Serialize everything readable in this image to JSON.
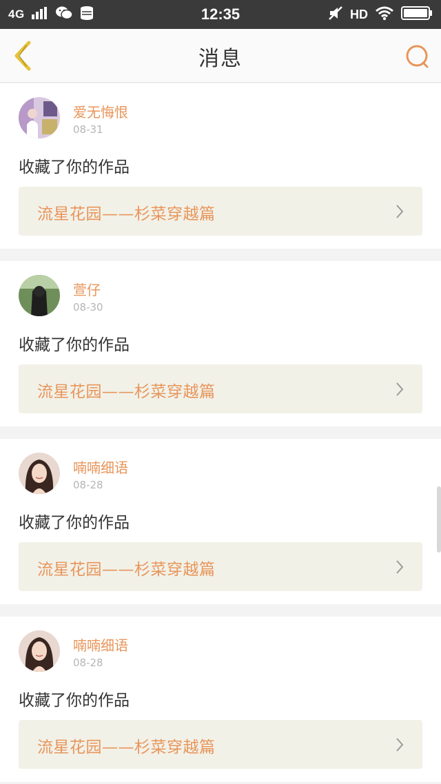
{
  "statusbar": {
    "network": "4G",
    "time": "12:35",
    "hd": "HD"
  },
  "header": {
    "title": "消息"
  },
  "messages": [
    {
      "username": "爱无悔恨",
      "date": "08-31",
      "action": "收藏了你的作品",
      "work_title": "流星花园——杉菜穿越篇"
    },
    {
      "username": "萱仔",
      "date": "08-30",
      "action": "收藏了你的作品",
      "work_title": "流星花园——杉菜穿越篇"
    },
    {
      "username": "喃喃细语",
      "date": "08-28",
      "action": "收藏了你的作品",
      "work_title": "流星花园——杉菜穿越篇"
    },
    {
      "username": "喃喃细语",
      "date": "08-28",
      "action": "收藏了你的作品",
      "work_title": "流星花园——杉菜穿越篇"
    }
  ],
  "colors": {
    "accent": "#e8955a",
    "back_icon": "#e6c13a",
    "card_link_bg": "#f2f1e8"
  },
  "icons": {
    "back": "chevron-left-icon",
    "search": "search-icon",
    "link_arrow": "chevron-right-icon"
  }
}
